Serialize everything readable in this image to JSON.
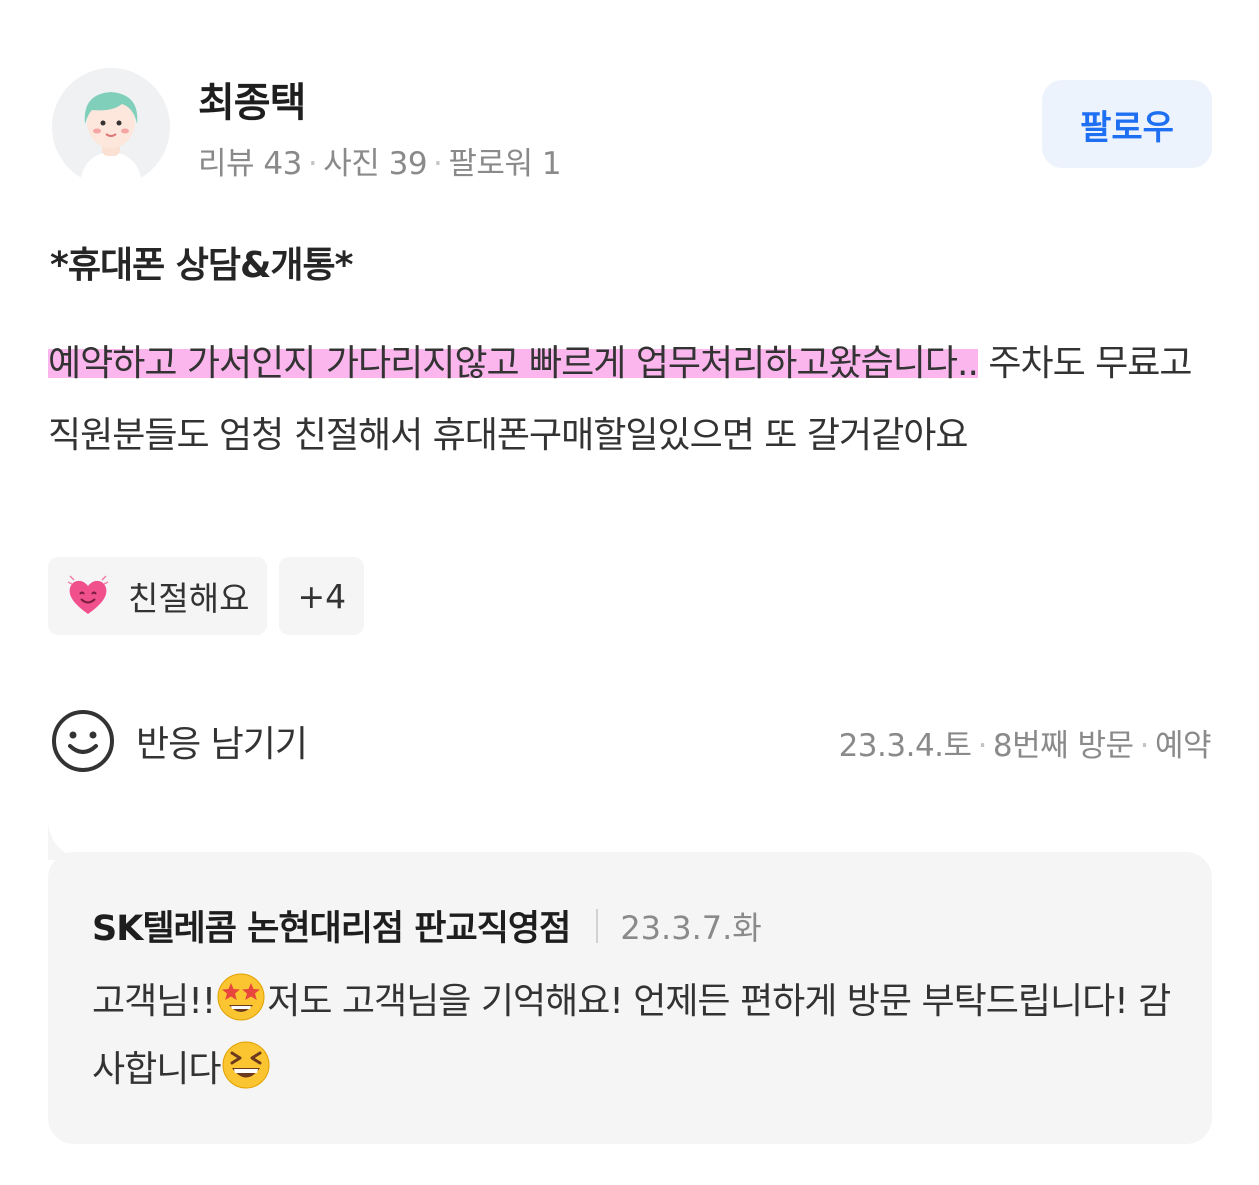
{
  "profile": {
    "name": "최종택",
    "stats": {
      "reviews": "리뷰 43",
      "photos": "사진 39",
      "followers": "팔로워 1"
    },
    "follow_label": "팔로우"
  },
  "review": {
    "title": "*휴대폰 상담&개통*",
    "highlighted_text": "예약하고 가서인지 가다리지않고 빠르게 업무처리하고왔습니다..",
    "body_text": "주차도 무료고 직원분들도 엄청 친절해서 휴대폰구매할일있으면 또 갈거같아요",
    "tags": [
      {
        "icon": "smiling-heart-icon",
        "label": "친절해요"
      }
    ],
    "more_tags": "+4",
    "react_label": "반응 남기기",
    "meta": {
      "date": "23.3.4.토",
      "visit": "8번째 방문",
      "type": "예약"
    }
  },
  "reply": {
    "owner": "SK텔레콤 논현대리점 판교직영점",
    "date": "23.3.7.화",
    "text_1": "고객님!!",
    "emoji_1": "star-struck-emoji",
    "text_2": "저도 고객님을 기억해요! 언제든 편하게 방문 부탁드립니다! 감사합니다",
    "emoji_2": "grinning-squint-emoji"
  },
  "colors": {
    "accent": "#1f6ff2",
    "follow_bg": "#edf3fd",
    "highlight": "#fbb6ee",
    "muted": "#8a8a8a",
    "card_bg": "#f5f5f5"
  }
}
